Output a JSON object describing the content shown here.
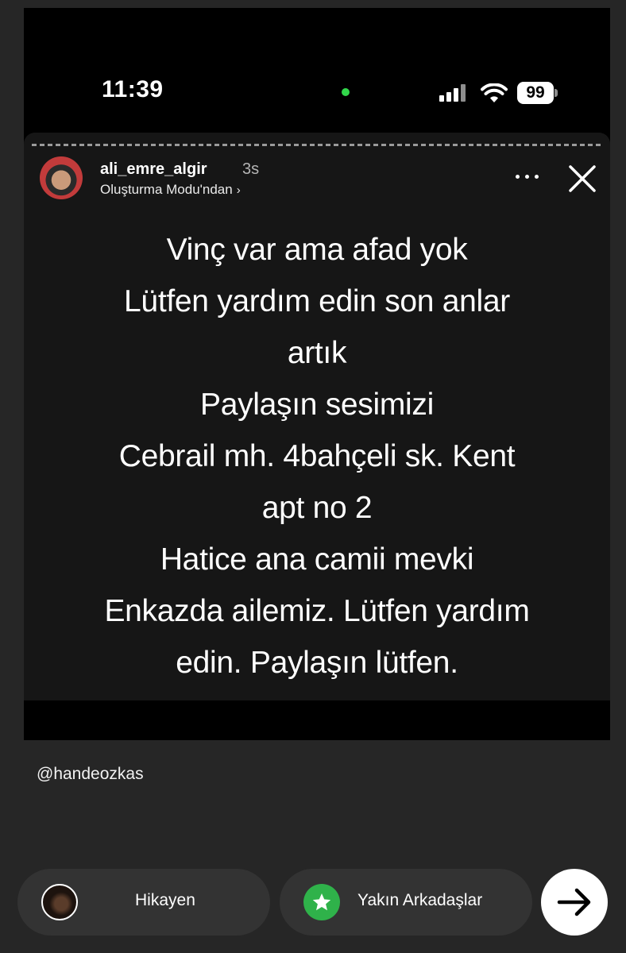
{
  "status_bar": {
    "time": "11:39",
    "battery": "99",
    "camera_indicator_color": "#32d74b"
  },
  "story": {
    "username": "ali_emre_algir",
    "timestamp": "3s",
    "subtitle": "Oluşturma Modu'ndan",
    "subtitle_chevron": "›",
    "icons": {
      "more": "more-horizontal-icon",
      "close": "close-icon"
    },
    "text_lines": [
      "Vinç var ama afad yok",
      "Lütfen yardım edin son anlar",
      "artık",
      "Paylaşın sesimizi",
      "Cebrail mh. 4bahçeli sk. Kent",
      "apt no 2",
      "Hatice ana camii mevki",
      "Enkazda ailemiz. Lütfen yardım",
      "edin. Paylaşın lütfen."
    ]
  },
  "mention": "@handeozkas",
  "share_bar": {
    "your_story_label": "Hikayen",
    "close_friends_label": "Yakın Arkadaşlar",
    "close_friends_color": "#2fb24a",
    "send_icon": "arrow-right-icon"
  }
}
